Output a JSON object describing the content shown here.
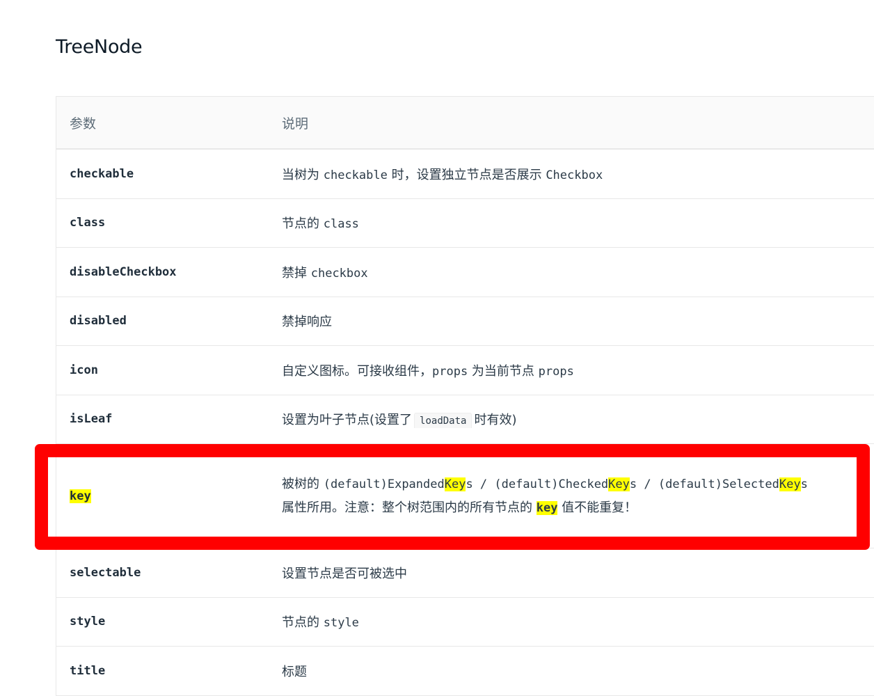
{
  "page": {
    "title": "TreeNode"
  },
  "table": {
    "headers": {
      "param": "参数",
      "desc": "说明"
    },
    "rows": [
      {
        "param": "checkable",
        "desc_parts": [
          "当树为 ",
          "checkable",
          " 时，设置独立节点是否展示 ",
          "Checkbox"
        ]
      },
      {
        "param": "class",
        "desc_parts": [
          "节点的 ",
          "class"
        ]
      },
      {
        "param": "disableCheckbox",
        "desc_parts": [
          "禁掉 ",
          "checkbox"
        ]
      },
      {
        "param": "disabled",
        "desc_parts": [
          "禁掉响应"
        ]
      },
      {
        "param": "icon",
        "desc_parts": [
          "自定义图标。可接收组件，",
          "props",
          " 为当前节点 ",
          "props"
        ]
      },
      {
        "param": "isLeaf",
        "desc_parts": [
          "设置为叶子节点(设置了",
          "loadData",
          "时有效)"
        ]
      },
      {
        "param": "key",
        "line1_parts": [
          "被树的 ",
          "(default)Expanded",
          "Key",
          "s / ",
          "(default)Checked",
          "Key",
          "s / ",
          "(default)Selected",
          "Key",
          "s"
        ],
        "line2_parts": [
          "属性所用。注意：整个树范围内的所有节点的 ",
          "key",
          " 值不能重复！"
        ]
      },
      {
        "param": "selectable",
        "desc_parts": [
          "设置节点是否可被选中"
        ]
      },
      {
        "param": "style",
        "desc_parts": [
          "节点的 ",
          "style"
        ]
      },
      {
        "param": "title",
        "desc_parts": [
          "标题"
        ]
      }
    ]
  },
  "colors": {
    "highlight_box": "#ff0000",
    "search_highlight": "#ffff00"
  }
}
